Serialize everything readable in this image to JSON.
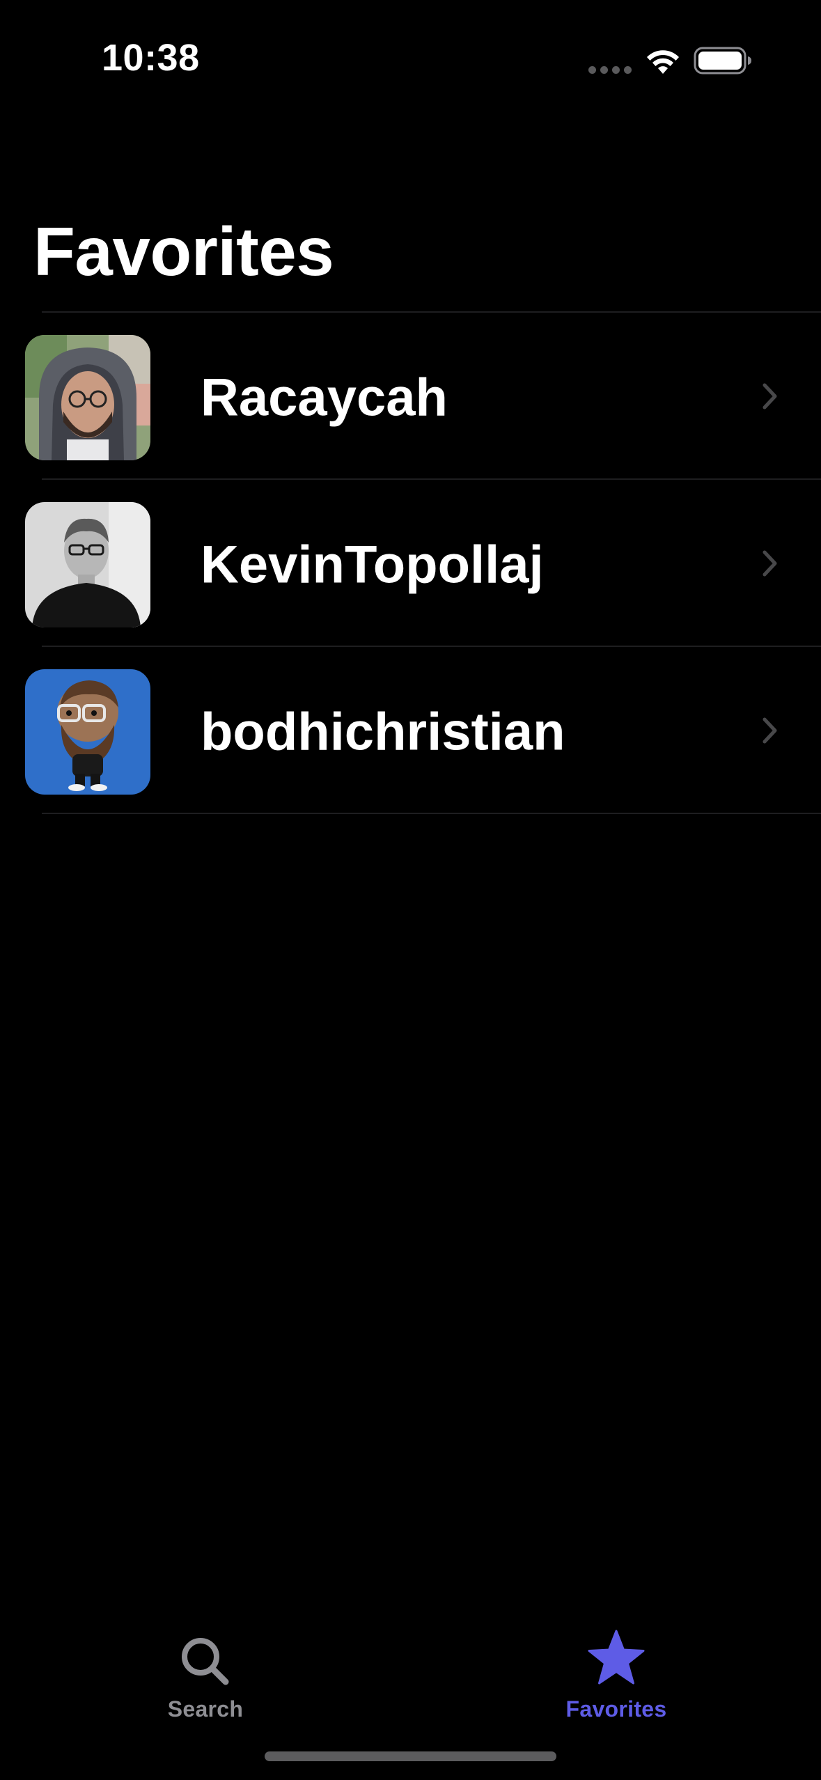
{
  "status_bar": {
    "time": "10:38",
    "icons": [
      "cellular-dots-icon",
      "wifi-icon",
      "battery-icon"
    ]
  },
  "page": {
    "title": "Favorites"
  },
  "favorites": [
    {
      "username": "Racaycah",
      "avatar": "avatar-man-hoodie-glasses"
    },
    {
      "username": "KevinTopollaj",
      "avatar": "avatar-man-black-shirt-glasses"
    },
    {
      "username": "bodhichristian",
      "avatar": "avatar-bearded-cartoon-figure"
    }
  ],
  "tab_bar": {
    "tabs": [
      {
        "label": "Search",
        "icon": "magnifying-glass-icon",
        "selected": false
      },
      {
        "label": "Favorites",
        "icon": "star-icon",
        "selected": true
      }
    ]
  },
  "colors": {
    "background": "#000000",
    "accent": "#5e5ce6",
    "inactive": "#8e8e93",
    "chevron": "#48484a",
    "separator": "#1e1e20"
  }
}
